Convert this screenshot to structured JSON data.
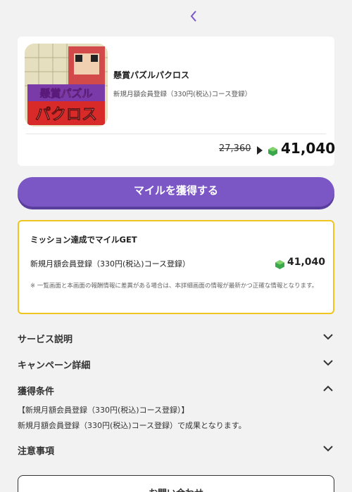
{
  "header": {
    "back_icon": "chevron-left-icon"
  },
  "offer": {
    "title": "懸賞パズルパクロス",
    "subtitle": "新規月額会員登録（330円(税込)コース登録）",
    "old_points": "27,360",
    "new_points": "41,040",
    "icon_text_line1": "懸賞パズル",
    "icon_text_line2": "パクロス"
  },
  "cta": {
    "label": "マイルを獲得する"
  },
  "mission": {
    "title": "ミッション達成でマイルGET",
    "item_label": "新規月額会員登録（330円(税込)コース登録）",
    "points": "41,040",
    "note": "※ 一覧画面と本画面の報酬情報に差異がある場合は、本詳細画面の情報が最新かつ正確な情報となります。"
  },
  "sections": {
    "service": "サービス説明",
    "campaign": "キャンペーン詳細",
    "conditions": "獲得条件",
    "conditions_line1": "【新規月額会員登録（330円(税込)コース登録）】",
    "conditions_line2": "新規月額会員登録（330円(税込)コース登録）で成果となります。",
    "notes": "注意事項"
  },
  "bottom": {
    "button_label": "お問い合わせ"
  },
  "colors": {
    "accent": "#7b57c6",
    "highlight": "#f1c41f",
    "gem": "#4caf50"
  }
}
